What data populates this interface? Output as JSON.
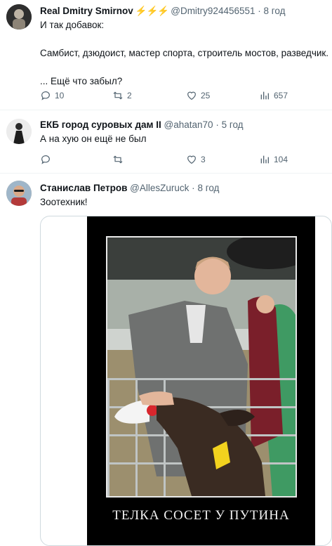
{
  "tweets": [
    {
      "name": "Real Dmitry Smirnov",
      "badge": "⚡⚡⚡",
      "handle": "@Dmitry924456551",
      "separator": "·",
      "time": "8 год",
      "text": "И так добавок:\n\nСамбист, дзюдоист, мастер спорта, строитель мостов, разведчик.\n\n... Ещё что забыл?",
      "replies": "10",
      "retweets": "2",
      "likes": "25",
      "views": "657"
    },
    {
      "name": "ЕКБ город суровых дам II",
      "handle": "@ahatan70",
      "separator": "·",
      "time": "5 год",
      "text": "А на хую он ещё не был",
      "replies": "",
      "retweets": "",
      "likes": "3",
      "views": "104"
    },
    {
      "name": "Станислав Петров",
      "handle": "@AllesZuruck",
      "separator": "·",
      "time": "8 год",
      "text": "Зоотехник!",
      "image_caption": "ТЕЛКА СОСЕТ У ПУТИНА"
    }
  ],
  "icons": [
    "reply-icon",
    "retweet-icon",
    "like-icon",
    "views-icon"
  ],
  "colors": {
    "badge": "#f5b400",
    "secondary_text": "#536471",
    "divider": "#eff3f4"
  }
}
